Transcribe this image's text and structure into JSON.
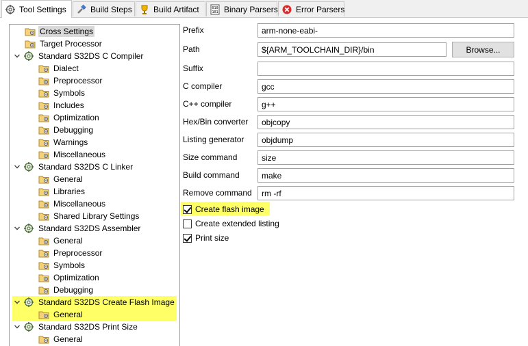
{
  "tabs": [
    {
      "label": "Tool Settings",
      "icon": "tool-settings-icon",
      "active": true
    },
    {
      "label": "Build Steps",
      "icon": "build-steps-icon",
      "active": false
    },
    {
      "label": "Build Artifact",
      "icon": "build-artifact-icon",
      "active": false
    },
    {
      "label": "Binary Parsers",
      "icon": "binary-parsers-icon",
      "active": false
    },
    {
      "label": "Error Parsers",
      "icon": "error-parsers-icon",
      "active": false
    }
  ],
  "tree": {
    "items": [
      {
        "label": "Cross Settings",
        "level": 1,
        "icon": "folder-gear-icon",
        "selected": true
      },
      {
        "label": "Target Processor",
        "level": 1,
        "icon": "folder-gear-icon"
      },
      {
        "label": "Standard S32DS C Compiler",
        "level": 0,
        "icon": "tool-gear-icon",
        "expanded": true
      },
      {
        "label": "Dialect",
        "level": 2,
        "icon": "folder-gear-icon"
      },
      {
        "label": "Preprocessor",
        "level": 2,
        "icon": "folder-gear-icon"
      },
      {
        "label": "Symbols",
        "level": 2,
        "icon": "folder-gear-icon"
      },
      {
        "label": "Includes",
        "level": 2,
        "icon": "folder-gear-icon"
      },
      {
        "label": "Optimization",
        "level": 2,
        "icon": "folder-gear-icon"
      },
      {
        "label": "Debugging",
        "level": 2,
        "icon": "folder-gear-icon"
      },
      {
        "label": "Warnings",
        "level": 2,
        "icon": "folder-gear-icon"
      },
      {
        "label": "Miscellaneous",
        "level": 2,
        "icon": "folder-gear-icon"
      },
      {
        "label": "Standard S32DS C Linker",
        "level": 0,
        "icon": "tool-gear-icon",
        "expanded": true
      },
      {
        "label": "General",
        "level": 2,
        "icon": "folder-gear-icon"
      },
      {
        "label": "Libraries",
        "level": 2,
        "icon": "folder-gear-icon"
      },
      {
        "label": "Miscellaneous",
        "level": 2,
        "icon": "folder-gear-icon"
      },
      {
        "label": "Shared Library Settings",
        "level": 2,
        "icon": "folder-gear-icon"
      },
      {
        "label": "Standard S32DS Assembler",
        "level": 0,
        "icon": "tool-gear-icon",
        "expanded": true
      },
      {
        "label": "General",
        "level": 2,
        "icon": "folder-gear-icon"
      },
      {
        "label": "Preprocessor",
        "level": 2,
        "icon": "folder-gear-icon"
      },
      {
        "label": "Symbols",
        "level": 2,
        "icon": "folder-gear-icon"
      },
      {
        "label": "Optimization",
        "level": 2,
        "icon": "folder-gear-icon"
      },
      {
        "label": "Debugging",
        "level": 2,
        "icon": "folder-gear-icon"
      },
      {
        "label": "Standard S32DS Create Flash Image",
        "level": 0,
        "icon": "tool-gear-icon",
        "expanded": true,
        "highlighted": true
      },
      {
        "label": "General",
        "level": 2,
        "icon": "folder-gear-icon",
        "highlighted": true
      },
      {
        "label": "Standard S32DS Print Size",
        "level": 0,
        "icon": "tool-gear-icon",
        "expanded": true
      },
      {
        "label": "General",
        "level": 2,
        "icon": "folder-gear-icon"
      }
    ]
  },
  "form": {
    "prefix": {
      "label": "Prefix",
      "value": "arm-none-eabi-"
    },
    "path": {
      "label": "Path",
      "value": "${ARM_TOOLCHAIN_DIR}/bin",
      "browse_label": "Browse..."
    },
    "suffix": {
      "label": "Suffix",
      "value": ""
    },
    "c_compiler": {
      "label": "C compiler",
      "value": "gcc"
    },
    "cpp_compiler": {
      "label": "C++ compiler",
      "value": "g++"
    },
    "hexbin": {
      "label": "Hex/Bin converter",
      "value": "objcopy"
    },
    "listing": {
      "label": "Listing generator",
      "value": "objdump"
    },
    "size_cmd": {
      "label": "Size command",
      "value": "size"
    },
    "build_cmd": {
      "label": "Build command",
      "value": "make"
    },
    "remove_cmd": {
      "label": "Remove command",
      "value": "rm -rf"
    }
  },
  "checkboxes": {
    "flash": {
      "label": "Create flash image",
      "checked": true,
      "highlighted": true
    },
    "listing": {
      "label": "Create extended listing",
      "checked": false
    },
    "print_size": {
      "label": "Print size",
      "checked": true
    }
  },
  "colors": {
    "highlight": "#ffff66",
    "selection": "#d9d9d9",
    "border": "#a0a0a0"
  }
}
